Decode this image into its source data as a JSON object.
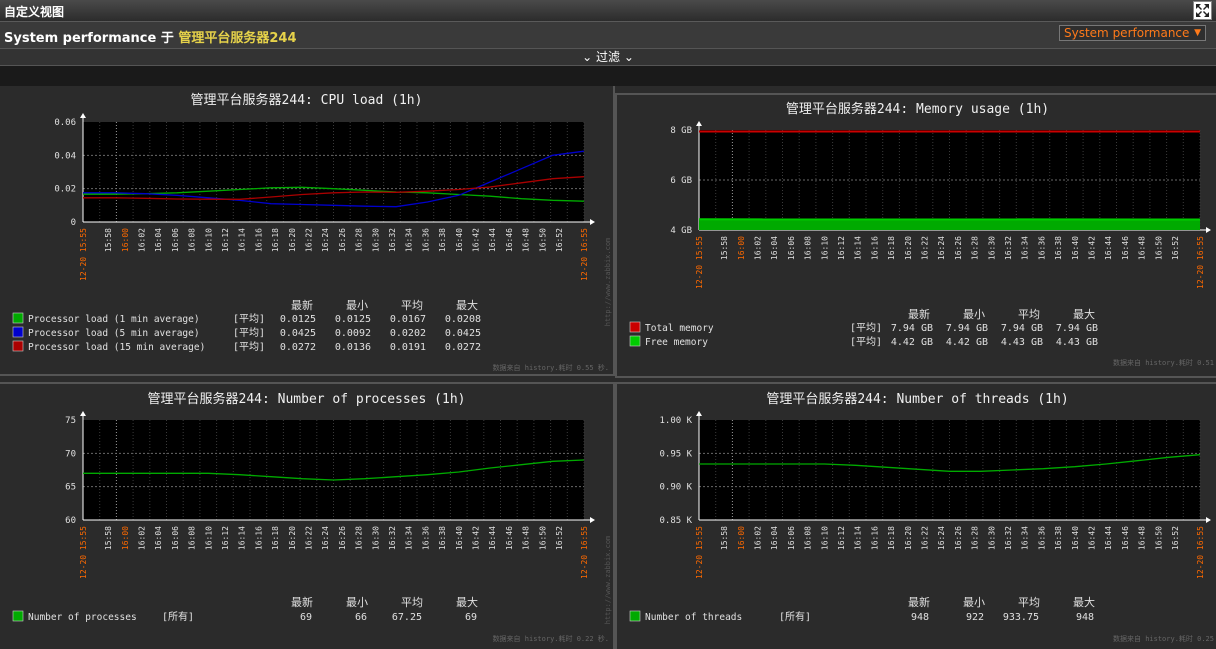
{
  "window": {
    "title": "自定义视图"
  },
  "header": {
    "title": "System performance",
    "sep": "于",
    "host": "管理平台服务器244",
    "select_value": "System performance"
  },
  "filter": {
    "label": "过滤"
  },
  "stat_headers": [
    "最新",
    "最小",
    "平均",
    "最大"
  ],
  "watermark": "http://www.zabbix.com",
  "time_ticks": [
    "15:58",
    "16:00",
    "16:02",
    "16:04",
    "16:06",
    "16:08",
    "16:10",
    "16:12",
    "16:14",
    "16:16",
    "16:18",
    "16:20",
    "16:22",
    "16:24",
    "16:26",
    "16:28",
    "16:30",
    "16:32",
    "16:34",
    "16:36",
    "16:38",
    "16:40",
    "16:42",
    "16:44",
    "16:46",
    "16:48",
    "16:50",
    "16:52"
  ],
  "time_start": "12-20 15:55",
  "time_end": "12-20 16:55",
  "charts": [
    {
      "type": "line",
      "title": "管理平台服务器244: CPU load (1h)",
      "yticks": [
        "0.06",
        "0.04",
        "0.02",
        "0"
      ],
      "ylim": [
        0,
        0.06
      ],
      "footer": "数据来自 history.耗时 0.55 秒.",
      "series": [
        {
          "name": "Processor load (1 min average)",
          "color": "#00aa00",
          "agg": "[平均]",
          "stats": [
            "0.0125",
            "0.0125",
            "0.0167",
            "0.0208"
          ],
          "values": [
            0.0167,
            0.0167,
            0.017,
            0.0175,
            0.0185,
            0.0195,
            0.0205,
            0.0208,
            0.02,
            0.019,
            0.018,
            0.0175,
            0.0165,
            0.0155,
            0.014,
            0.013,
            0.0125
          ]
        },
        {
          "name": "Processor load (5 min average)",
          "color": "#0000cc",
          "agg": "[平均]",
          "stats": [
            "0.0425",
            "0.0092",
            "0.0202",
            "0.0425"
          ],
          "values": [
            0.0175,
            0.0175,
            0.017,
            0.016,
            0.0145,
            0.013,
            0.011,
            0.0105,
            0.01,
            0.0095,
            0.0092,
            0.012,
            0.016,
            0.024,
            0.032,
            0.04,
            0.0425
          ]
        },
        {
          "name": "Processor load (15 min average)",
          "color": "#aa0000",
          "agg": "[平均]",
          "stats": [
            "0.0272",
            "0.0136",
            "0.0191",
            "0.0272"
          ],
          "values": [
            0.0145,
            0.0145,
            0.0142,
            0.0138,
            0.0137,
            0.0136,
            0.015,
            0.0165,
            0.0175,
            0.018,
            0.0178,
            0.0185,
            0.0195,
            0.021,
            0.0235,
            0.026,
            0.0272
          ]
        }
      ]
    },
    {
      "type": "area",
      "title": "管理平台服务器244: Memory usage (1h)",
      "yticks": [
        "8 GB",
        "6 GB",
        "4 GB"
      ],
      "ylim": [
        4,
        8
      ],
      "footer": "数据来自 history.耗时 0.51",
      "series": [
        {
          "name": "Total memory",
          "color": "#cc0000",
          "agg": "[平均]",
          "stats": [
            "7.94 GB",
            "7.94 GB",
            "7.94 GB",
            "7.94 GB"
          ],
          "values": [
            7.94,
            7.94
          ]
        },
        {
          "name": "Free memory",
          "color": "#00cc00",
          "agg": "[平均]",
          "stats": [
            "4.42 GB",
            "4.42 GB",
            "4.43 GB",
            "4.43 GB"
          ],
          "values": [
            4.43,
            4.42
          ]
        }
      ]
    },
    {
      "type": "line",
      "title": "管理平台服务器244: Number of processes (1h)",
      "yticks": [
        "75",
        "70",
        "65",
        "60"
      ],
      "ylim": [
        60,
        75
      ],
      "footer": "数据来自 history.耗时 0.22 秒.",
      "series": [
        {
          "name": "Number of processes",
          "color": "#00aa00",
          "agg": "[所有]",
          "stats": [
            "69",
            "66",
            "67.25",
            "69"
          ],
          "values": [
            67,
            67,
            67,
            67,
            67,
            66.8,
            66.5,
            66.2,
            66,
            66.2,
            66.5,
            66.8,
            67.2,
            67.8,
            68.3,
            68.8,
            69
          ]
        }
      ]
    },
    {
      "type": "line",
      "title": "管理平台服务器244: Number of threads (1h)",
      "yticks": [
        "1.00 K",
        "0.95 K",
        "0.90 K",
        "0.85 K"
      ],
      "ylim": [
        850,
        1000
      ],
      "footer": "数据来自 history.耗时 0.25",
      "series": [
        {
          "name": "Number of threads",
          "color": "#00aa00",
          "agg": "[所有]",
          "stats": [
            "948",
            "922",
            "933.75",
            "948"
          ],
          "values": [
            934,
            934,
            934,
            934,
            934,
            932,
            929,
            926,
            923,
            923,
            925,
            927,
            930,
            934,
            939,
            944,
            948
          ]
        }
      ]
    }
  ]
}
